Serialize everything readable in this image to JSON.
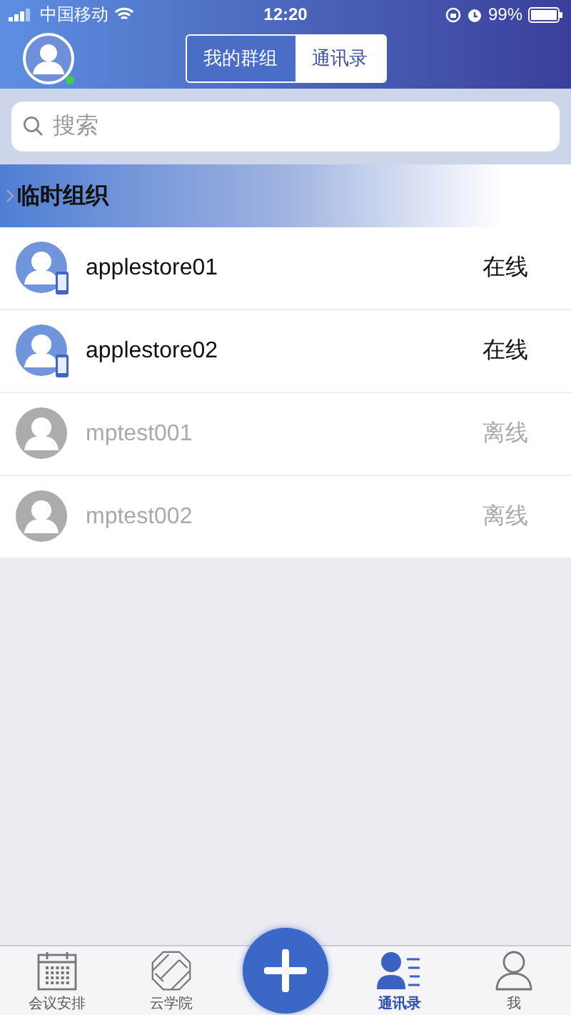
{
  "status_bar": {
    "carrier": "中国移动",
    "time": "12:20",
    "battery": "99%"
  },
  "header": {
    "avatar_online": true,
    "segments": [
      {
        "label": "我的群组",
        "selected": true
      },
      {
        "label": "通讯录",
        "selected": false
      }
    ]
  },
  "search": {
    "placeholder": "搜索"
  },
  "group": {
    "title": "临时组织",
    "expanded": false
  },
  "contacts": [
    {
      "name": "applestore01",
      "status": "在线",
      "online": true
    },
    {
      "name": "applestore02",
      "status": "在线",
      "online": true
    },
    {
      "name": "mptest001",
      "status": "离线",
      "online": false
    },
    {
      "name": "mptest002",
      "status": "离线",
      "online": false
    }
  ],
  "tab_bar": [
    {
      "label": "会议安排",
      "kind": "calendar",
      "selected": false
    },
    {
      "label": "云学院",
      "kind": "academy",
      "selected": false
    },
    {
      "kind": "add"
    },
    {
      "label": "通讯录",
      "kind": "contacts",
      "selected": true
    },
    {
      "label": "我",
      "kind": "me",
      "selected": false
    }
  ]
}
